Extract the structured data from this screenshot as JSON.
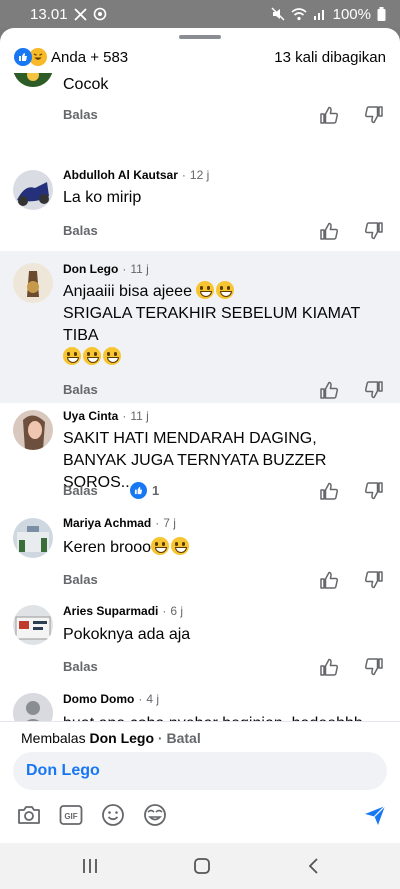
{
  "status_bar": {
    "time": "13.01",
    "battery": "100%"
  },
  "header": {
    "reactions_label": "Anda + 583",
    "shares_label": "13 kali dibagikan"
  },
  "comments": [
    {
      "name": "",
      "time": "",
      "text": "Cocok",
      "reply": "Balas"
    },
    {
      "name": "Abdulloh Al Kautsar",
      "time": "12 j",
      "text": "La ko mirip",
      "reply": "Balas"
    },
    {
      "name": "Don Lego",
      "time": "11 j",
      "text": "Anjaaiii bisa ajeee",
      "text2": "SRIGALA TERAKHIR SEBELUM KIAMAT TIBA",
      "reply": "Balas"
    },
    {
      "name": "Uya Cinta",
      "time": "11 j",
      "text": "SAKIT HATI MENDARAH DAGING, BANYAK JUGA TERNYATA BUZZER SOROS..",
      "reply": "Balas",
      "likes": "1"
    },
    {
      "name": "Mariya Achmad",
      "time": "7 j",
      "text": "Keren brooo",
      "reply": "Balas"
    },
    {
      "name": "Aries Suparmadi",
      "time": "6 j",
      "text": "Pokoknya ada aja",
      "reply": "Balas"
    },
    {
      "name": "Domo Domo",
      "time": "4 j",
      "text": "buat apa coba nyebar beginian, hadeehhh. mending fokus membangun negeri ini sama"
    }
  ],
  "replybar": {
    "prefix": "Membalas ",
    "target": "Don Lego",
    "cancel": "Batal",
    "input_value": "Don Lego"
  },
  "colors": {
    "accent": "#1877f2",
    "muted": "#65676b",
    "highlight_bg": "#f0f2f5"
  },
  "icons": [
    "camera-icon",
    "gif-icon",
    "emoji-icon",
    "sticker-icon",
    "send-icon",
    "like-icon",
    "dislike-icon",
    "recent-apps-icon",
    "home-icon",
    "back-icon"
  ]
}
